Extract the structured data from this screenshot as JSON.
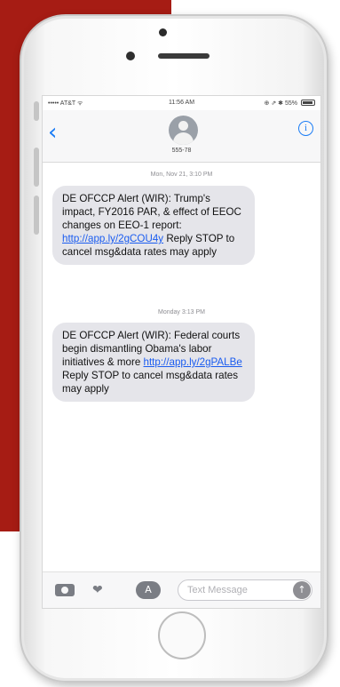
{
  "status_bar": {
    "carrier": "••••• AT&T ᯤ",
    "time": "11:56 AM",
    "right": "⊕ ⇗ ✱ 55%"
  },
  "nav": {
    "contact": "555-78",
    "back_icon": "chevron-left-icon",
    "info_icon": "info-icon"
  },
  "messages": [
    {
      "timestamp": "Mon, Nov 21, 3:10 PM",
      "text_before": "DE OFCCP Alert (WIR): Trump's impact, FY2016 PAR, & effect of EEOC changes on EEO-1 report: ",
      "link": "http://app.ly/2gCOU4y",
      "text_after": "Reply STOP to cancel msg&data rates may apply"
    },
    {
      "timestamp": "Monday 3:13 PM",
      "text_before": "DE OFCCP Alert (WIR): Federal courts begin dismantling Obama's labor initiatives & more ",
      "link": "http://app.ly/2gPALBe",
      "text_after": "Reply STOP to cancel msg&data rates may apply"
    }
  ],
  "composer": {
    "placeholder": "Text Message",
    "send_icon": "arrow-up-icon"
  },
  "colors": {
    "background_accent": "#a61c14",
    "ios_blue": "#1a7cf5",
    "bubble": "#e5e5ea"
  }
}
